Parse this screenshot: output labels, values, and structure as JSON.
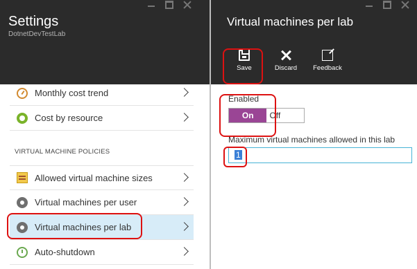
{
  "settings_blade": {
    "title": "Settings",
    "subtitle": "DotnetDevTestLab",
    "items_top": [
      {
        "label": "Monthly cost trend",
        "icon": "gauge-icon"
      },
      {
        "label": "Cost by resource",
        "icon": "cost-icon"
      }
    ],
    "section_header": "VIRTUAL MACHINE POLICIES",
    "items_policies": [
      {
        "label": "Allowed virtual machine sizes",
        "icon": "vm-sizes-icon"
      },
      {
        "label": "Virtual machines per user",
        "icon": "gear-icon"
      },
      {
        "label": "Virtual machines per lab",
        "icon": "gear-icon",
        "selected": true
      },
      {
        "label": "Auto-shutdown",
        "icon": "clock-icon"
      }
    ]
  },
  "vm_blade": {
    "title": "Virtual machines per lab",
    "commands": {
      "save": "Save",
      "discard": "Discard",
      "feedback": "Feedback"
    },
    "enabled_label": "Enabled",
    "toggle_on": "On",
    "toggle_off": "Off",
    "toggle_selected": "On",
    "max_label": "Maximum virtual machines allowed in this lab",
    "max_value": "1"
  },
  "colors": {
    "header_bg": "#2b2b2b",
    "toggle_on_bg": "#9a4595",
    "selected_row_bg": "#d7ecf8",
    "input_border": "#46b3d6",
    "annotation_red": "#dd1111"
  }
}
